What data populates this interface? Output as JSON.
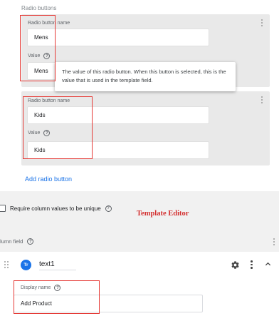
{
  "radio_section": {
    "title": "Radio buttons",
    "buttons": [
      {
        "name_label": "Radio button name",
        "name_value": "Mens",
        "value_label": "Value",
        "value_value": "Mens"
      },
      {
        "name_label": "Radio button name",
        "name_value": "Kids",
        "value_label": "Value",
        "value_value": "Kids"
      }
    ],
    "tooltip": "The value of this radio button. When this button is selected, this is the value that is used in the template field.",
    "add_label": "Add radio button"
  },
  "unique": {
    "label": "Require column values to be unique",
    "checked": false
  },
  "annotation": "Template Editor",
  "column_field": {
    "label": "Column field",
    "visible_label": "olumn field"
  },
  "field": {
    "type_badge": "Tr",
    "name": "text1",
    "display_name_label": "Display name",
    "display_name_value": "Add Product"
  },
  "colors": {
    "accent": "#1a73e8",
    "highlight": "#e53935",
    "annotation": "#d32f2f"
  }
}
